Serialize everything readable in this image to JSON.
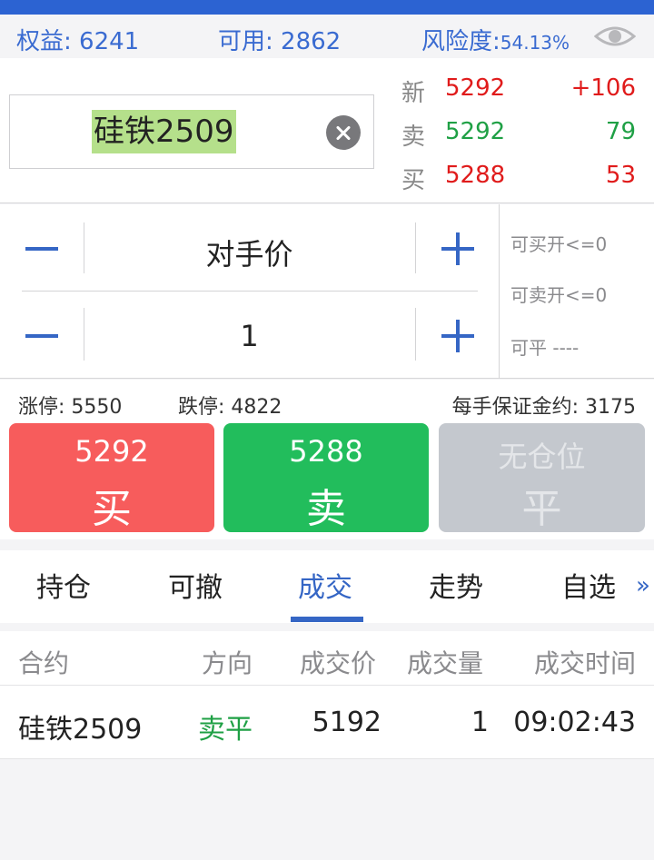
{
  "account": {
    "equity_label": "权益:",
    "equity_value": "6241",
    "available_label": "可用:",
    "available_value": "2862",
    "risk_label": "风险度:",
    "risk_value": "54.13%",
    "eye_icon": "eye-icon"
  },
  "quote": {
    "symbol": "硅铁2509",
    "clear_icon": "close-circle-icon",
    "rows": [
      {
        "label": "新",
        "value": "5292",
        "change": "+106"
      },
      {
        "label": "卖",
        "value": "5292",
        "change": "79"
      },
      {
        "label": "买",
        "value": "5288",
        "change": "53"
      }
    ]
  },
  "order": {
    "price_type": "对手价",
    "quantity": "1",
    "can_buy_open": "可买开<=0",
    "can_sell_open": "可卖开<=0",
    "can_close": "可平 ----"
  },
  "limits": {
    "limit_up": "涨停: 5550",
    "limit_down": "跌停: 4822",
    "margin": "每手保证金约: 3175"
  },
  "buttons": {
    "buy_price": "5292",
    "buy_label": "买",
    "sell_price": "5288",
    "sell_label": "卖",
    "close_status": "无仓位",
    "close_label": "平"
  },
  "tabs": [
    "持仓",
    "可撤",
    "成交",
    "走势",
    "自选"
  ],
  "active_tab": "成交",
  "more_icon": "double-chevron-right-icon",
  "trades": {
    "headers": [
      "合约",
      "方向",
      "成交价",
      "成交量",
      "成交时间"
    ],
    "rows": [
      {
        "contract": "硅铁2509",
        "direction": "卖平",
        "price": "5192",
        "volume": "1",
        "time": "09:02:43"
      }
    ]
  },
  "colors": {
    "accent": "#3566c5",
    "up": "#e01b1b",
    "down": "#1fa045",
    "buy_button": "#f75c5c",
    "sell_button": "#22bd5c",
    "disabled_button": "#c4c8ce"
  }
}
